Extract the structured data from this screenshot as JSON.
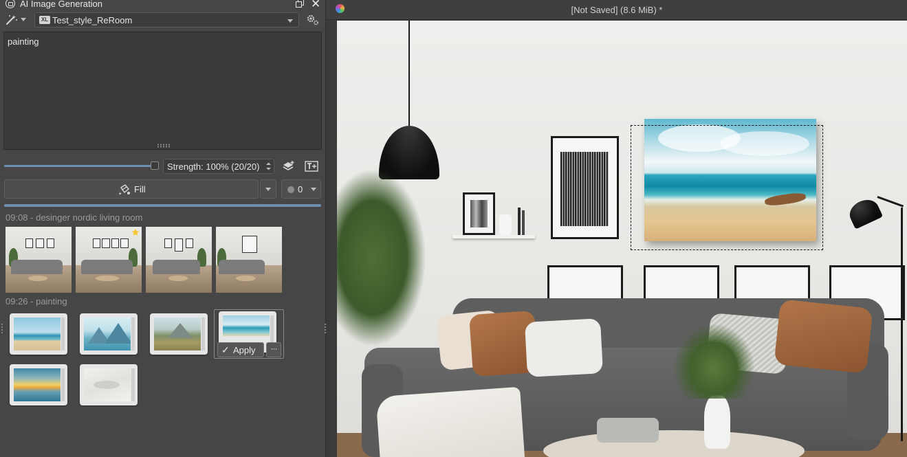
{
  "docker": {
    "title": "AI Image Generation",
    "style_name": "Test_style_ReRoom",
    "style_badge": "XL",
    "prompt": "painting",
    "strength_label": "Strength: 100% (20/20)",
    "strength_value": 1.0,
    "fill_label": "Fill",
    "queue_count": "0",
    "progress": 1.0
  },
  "history": {
    "groups": [
      {
        "header": "09:08 - desinger nordic living room",
        "count": 4,
        "starred_index": 1
      },
      {
        "header": "09:26 - painting",
        "count": 6,
        "selected_index": 3
      }
    ],
    "apply_label": "Apply",
    "more_label": "···"
  },
  "canvas": {
    "title": "[Not Saved]  (8.6 MiB) *"
  },
  "colors": {
    "accent": "#6d8fb2",
    "panel_bg": "#464646",
    "star": "#f4c430"
  }
}
